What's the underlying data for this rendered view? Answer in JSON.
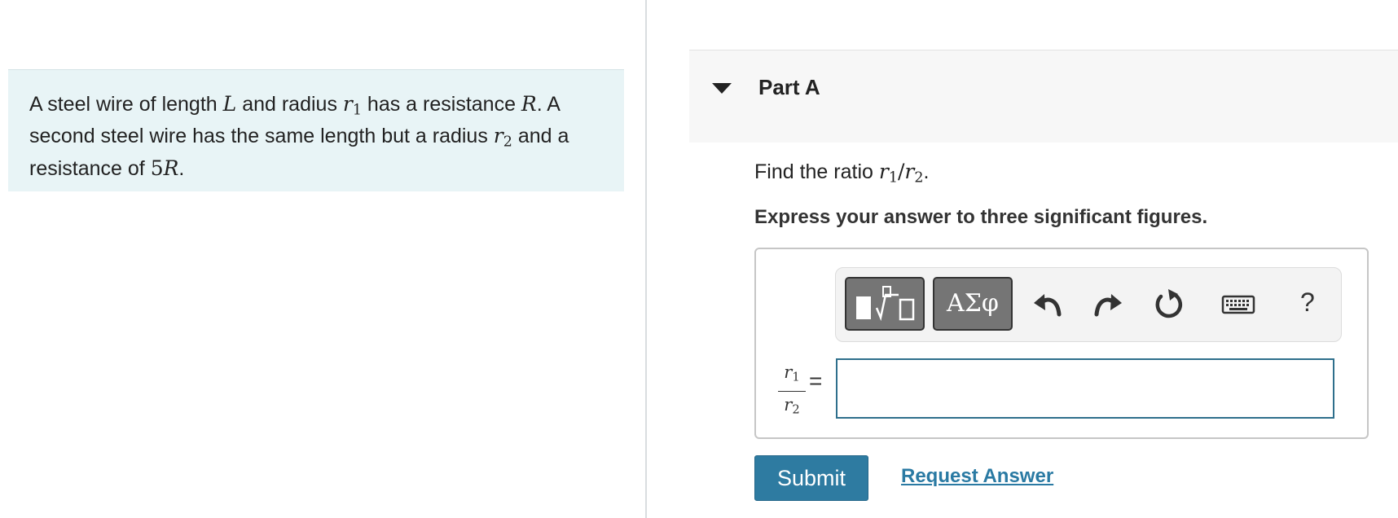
{
  "problem": {
    "segments": [
      {
        "t": "text",
        "v": "A steel wire of length "
      },
      {
        "t": "math",
        "v": "L"
      },
      {
        "t": "text",
        "v": " and radius "
      },
      {
        "t": "math",
        "v": "r",
        "sub": "1"
      },
      {
        "t": "text",
        "v": " has a resistance "
      },
      {
        "t": "math",
        "v": "R"
      },
      {
        "t": "text",
        "v": ". A second steel wire has the same length but a radius "
      },
      {
        "t": "math",
        "v": "r",
        "sub": "2"
      },
      {
        "t": "text",
        "v": " and a resistance of "
      },
      {
        "t": "mathup",
        "v": "5"
      },
      {
        "t": "math",
        "v": "R"
      },
      {
        "t": "text",
        "v": "."
      }
    ]
  },
  "part": {
    "title": "Part A",
    "question_prefix": "Find the ratio ",
    "ratio_num_var": "r",
    "ratio_num_sub": "1",
    "ratio_slash": "/",
    "ratio_den_var": "r",
    "ratio_den_sub": "2",
    "question_suffix": ".",
    "instruction": "Express your answer to three significant figures."
  },
  "toolbar": {
    "greek_label": "ΑΣφ",
    "help_label": "?",
    "icons": [
      "templates-icon",
      "undo-icon",
      "redo-icon",
      "reset-icon",
      "keyboard-icon",
      "help-icon"
    ]
  },
  "answer": {
    "fraction_num_var": "r",
    "fraction_num_sub": "1",
    "fraction_den_var": "r",
    "fraction_den_sub": "2",
    "equals": "=",
    "value": ""
  },
  "actions": {
    "submit_label": "Submit",
    "request_label": "Request Answer"
  },
  "colors": {
    "problem_bg": "#e8f4f6",
    "submit_bg": "#2e7ba1",
    "link": "#2a7aa3",
    "input_border": "#2e6f8c"
  }
}
